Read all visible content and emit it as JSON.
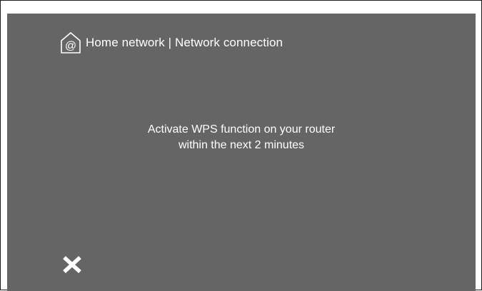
{
  "header": {
    "icon": "home-at-icon",
    "title": "Home network | Network connection"
  },
  "message": {
    "line1": "Activate WPS function on your router",
    "line2": "within the next 2 minutes"
  },
  "close_button": {
    "icon": "close-x-icon"
  },
  "colors": {
    "screen_background": "#656565",
    "text": "#ffffff",
    "frame_border": "#1a1a1a"
  }
}
